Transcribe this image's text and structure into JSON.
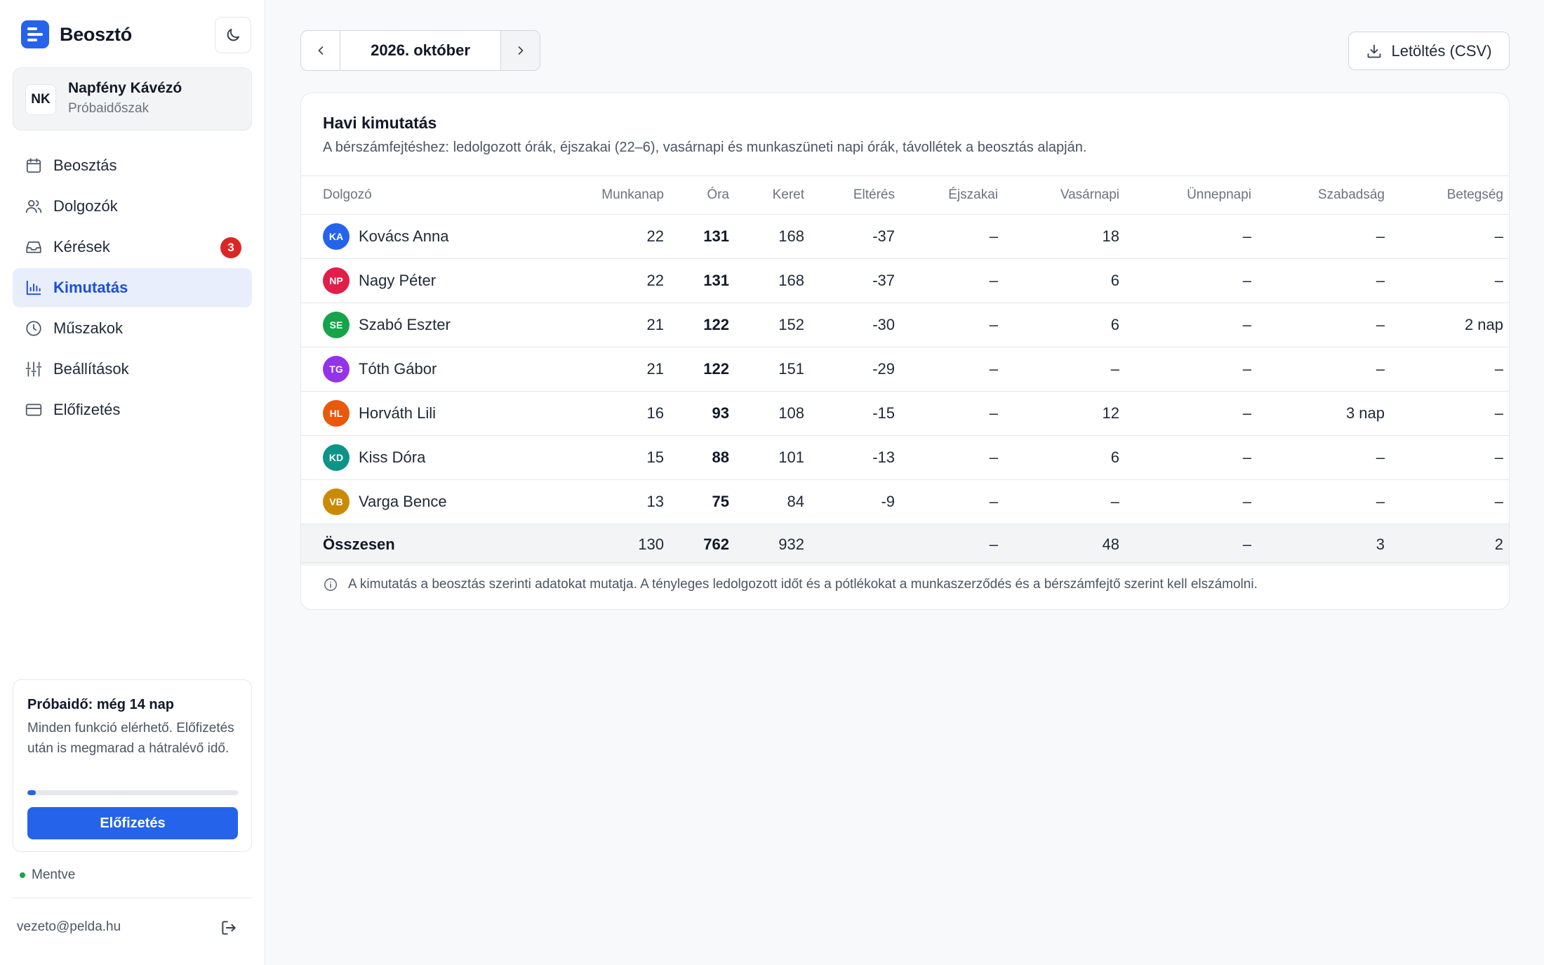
{
  "app": {
    "name": "Beosztó"
  },
  "org": {
    "initials": "NK",
    "name": "Napfény Kávézó",
    "status": "Próbaidőszak"
  },
  "nav": [
    {
      "label": "Beosztás",
      "icon": "calendar-icon",
      "active": false
    },
    {
      "label": "Dolgozók",
      "icon": "users-icon",
      "active": false
    },
    {
      "label": "Kérések",
      "icon": "inbox-icon",
      "active": false,
      "badge": "3"
    },
    {
      "label": "Kimutatás",
      "icon": "bar-chart-icon",
      "active": true
    },
    {
      "label": "Műszakok",
      "icon": "clock-icon",
      "active": false
    },
    {
      "label": "Beállítások",
      "icon": "sliders-icon",
      "active": false
    },
    {
      "label": "Előfizetés",
      "icon": "credit-card-icon",
      "active": false
    }
  ],
  "trial": {
    "title": "Próbaidő: még 14 nap",
    "text": "Minden funkció elérhető. Előfizetés után is megmarad a hátralévő idő.",
    "progress": 0.04,
    "button": "Előfizetés"
  },
  "saved_status": "Mentve",
  "user": {
    "email": "vezeto@pelda.hu"
  },
  "month": {
    "label": "2026. október"
  },
  "download": {
    "label": "Letöltés (CSV)"
  },
  "report": {
    "title": "Havi kimutatás",
    "subtitle": "A bérszámfejtéshez: ledolgozott órák, éjszakai (22–6), vasárnapi és munkaszüneti napi órák, távollétek a beosztás alapján.",
    "columns": [
      "Dolgozó",
      "Munkanap",
      "Óra",
      "Keret",
      "Eltérés",
      "Éjszakai",
      "Vasárnapi",
      "Ünnepnapi",
      "Szabadság",
      "Betegség"
    ],
    "rows": [
      {
        "initials": "KA",
        "color": "#2563eb",
        "name": "Kovács Anna",
        "munkanap": "22",
        "ora": "131",
        "keret": "168",
        "elteres": "-37",
        "ejszakai": "–",
        "vasarnapi": "18",
        "unnepnapi": "–",
        "szabadsag": "–",
        "betegseg": "–"
      },
      {
        "initials": "NP",
        "color": "#e11d48",
        "name": "Nagy Péter",
        "munkanap": "22",
        "ora": "131",
        "keret": "168",
        "elteres": "-37",
        "ejszakai": "–",
        "vasarnapi": "6",
        "unnepnapi": "–",
        "szabadsag": "–",
        "betegseg": "–"
      },
      {
        "initials": "SE",
        "color": "#16a34a",
        "name": "Szabó Eszter",
        "munkanap": "21",
        "ora": "122",
        "keret": "152",
        "elteres": "-30",
        "ejszakai": "–",
        "vasarnapi": "6",
        "unnepnapi": "–",
        "szabadsag": "–",
        "betegseg": "2 nap"
      },
      {
        "initials": "TG",
        "color": "#9333ea",
        "name": "Tóth Gábor",
        "munkanap": "21",
        "ora": "122",
        "keret": "151",
        "elteres": "-29",
        "ejszakai": "–",
        "vasarnapi": "–",
        "unnepnapi": "–",
        "szabadsag": "–",
        "betegseg": "–"
      },
      {
        "initials": "HL",
        "color": "#ea580c",
        "name": "Horváth Lili",
        "munkanap": "16",
        "ora": "93",
        "keret": "108",
        "elteres": "-15",
        "ejszakai": "–",
        "vasarnapi": "12",
        "unnepnapi": "–",
        "szabadsag": "3 nap",
        "betegseg": "–"
      },
      {
        "initials": "KD",
        "color": "#0d9488",
        "name": "Kiss Dóra",
        "munkanap": "15",
        "ora": "88",
        "keret": "101",
        "elteres": "-13",
        "ejszakai": "–",
        "vasarnapi": "6",
        "unnepnapi": "–",
        "szabadsag": "–",
        "betegseg": "–"
      },
      {
        "initials": "VB",
        "color": "#ca8a04",
        "name": "Varga Bence",
        "munkanap": "13",
        "ora": "75",
        "keret": "84",
        "elteres": "-9",
        "ejszakai": "–",
        "vasarnapi": "–",
        "unnepnapi": "–",
        "szabadsag": "–",
        "betegseg": "–"
      }
    ],
    "total": {
      "label": "Összesen",
      "munkanap": "130",
      "ora": "762",
      "keret": "932",
      "elteres": "",
      "ejszakai": "–",
      "vasarnapi": "48",
      "unnepnapi": "–",
      "szabadsag": "3",
      "betegseg": "2"
    },
    "note": "A kimutatás a beosztás szerinti adatokat mutatja. A tényleges ledolgozott időt és a pótlékokat a munkaszerződés és a bérszámfejtő szerint kell elszámolni."
  },
  "colors": {
    "accent": "#2563eb",
    "badge": "#dc2626",
    "saved": "#16a34a"
  }
}
